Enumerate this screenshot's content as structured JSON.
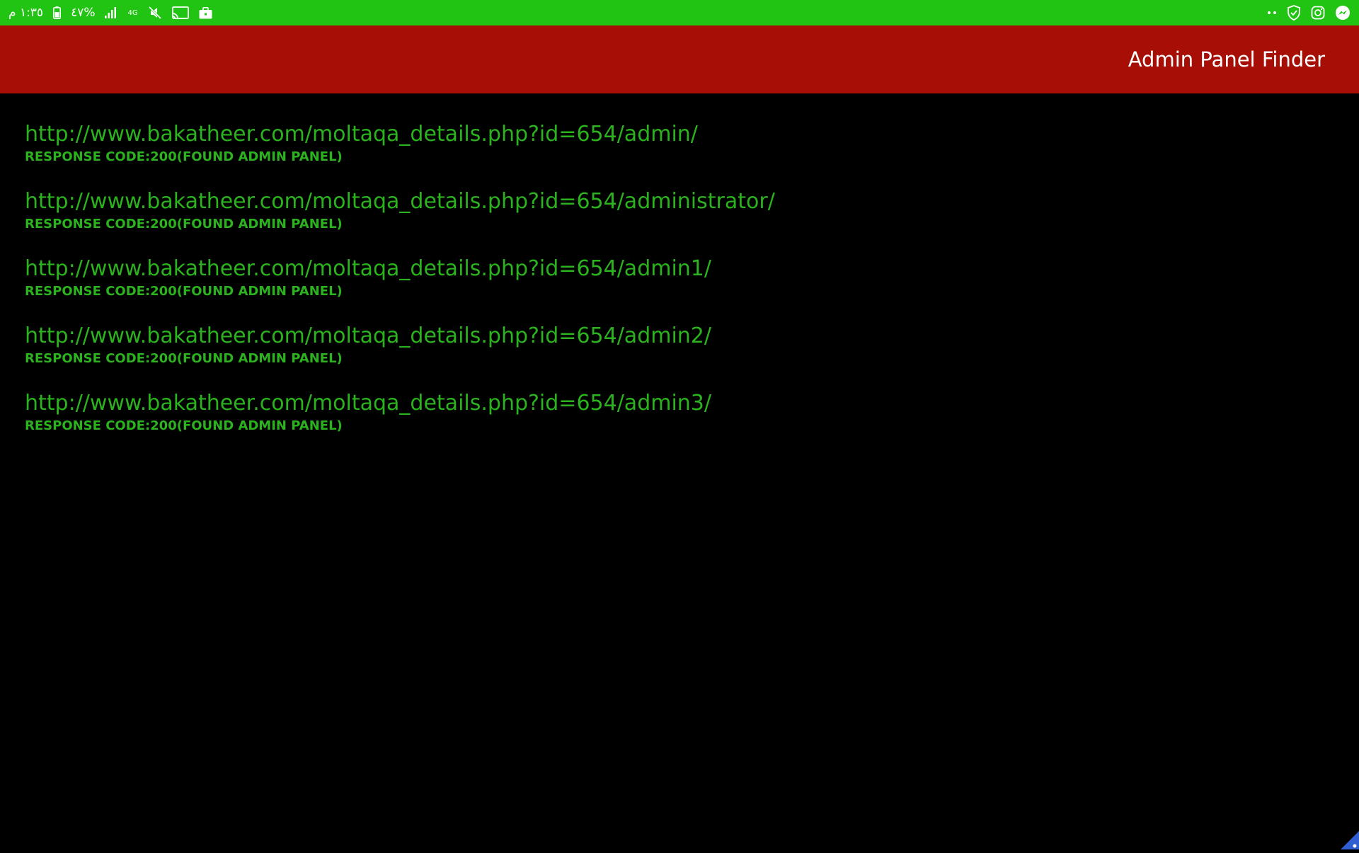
{
  "status_bar": {
    "time": "١:٣٥ م",
    "battery_percent": "%٤٧",
    "network_type": "4G",
    "icons_left": [
      "battery-icon",
      "signal-icon",
      "network-4g-icon",
      "mute-icon",
      "cast-icon",
      "work-profile-icon"
    ],
    "icons_right": [
      "more-dots-icon",
      "shield-icon",
      "instagram-icon",
      "messenger-icon"
    ],
    "background": "#22c413"
  },
  "app_bar": {
    "title": "Admin Panel Finder",
    "background": "#a60e06"
  },
  "results": [
    {
      "url": "http://www.bakatheer.com/moltaqa_details.php?id=654/admin/",
      "status": "RESPONSE CODE:200(FOUND ADMIN PANEL)"
    },
    {
      "url": "http://www.bakatheer.com/moltaqa_details.php?id=654/administrator/",
      "status": "RESPONSE CODE:200(FOUND ADMIN PANEL)"
    },
    {
      "url": "http://www.bakatheer.com/moltaqa_details.php?id=654/admin1/",
      "status": "RESPONSE CODE:200(FOUND ADMIN PANEL)"
    },
    {
      "url": "http://www.bakatheer.com/moltaqa_details.php?id=654/admin2/",
      "status": "RESPONSE CODE:200(FOUND ADMIN PANEL)"
    },
    {
      "url": "http://www.bakatheer.com/moltaqa_details.php?id=654/admin3/",
      "status": "RESPONSE CODE:200(FOUND ADMIN PANEL)"
    }
  ],
  "colors": {
    "result_text": "#2bb21e",
    "page_background": "#000000"
  }
}
